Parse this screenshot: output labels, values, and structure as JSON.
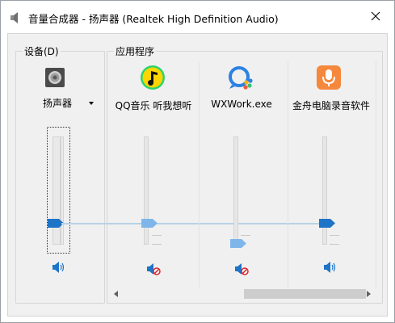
{
  "window": {
    "title": "音量合成器 - 扬声器 (Realtek High Definition Audio)"
  },
  "device_section": {
    "label": "设备(D)",
    "device_name": "扬声器",
    "volume_level": 0.2
  },
  "apps_section": {
    "label": "应用程序",
    "apps": [
      {
        "name": "QQ音乐 听我想听",
        "icon": "qq-music-icon",
        "volume_level": 0.2,
        "muted": true
      },
      {
        "name": "WXWork.exe",
        "icon": "wxwork-icon",
        "volume_level": 0.04,
        "muted": true
      },
      {
        "name": "金舟电脑录音软件",
        "icon": "recorder-icon",
        "volume_level": 0.2,
        "muted": false
      }
    ]
  },
  "colors": {
    "accent": "#1e74c6",
    "muted_thumb": "#7fb6ea",
    "mute_red": "#d9262c"
  }
}
